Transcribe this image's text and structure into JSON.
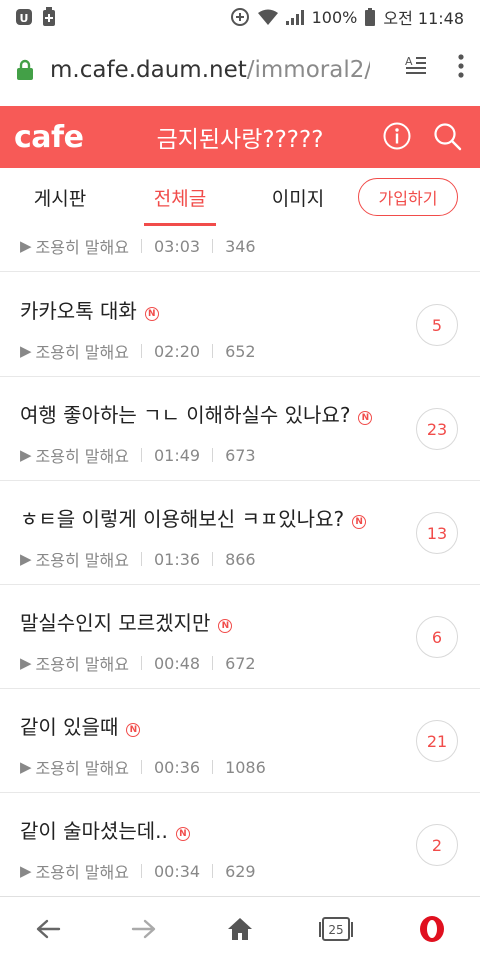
{
  "status_bar": {
    "battery": "100%",
    "time": "오전 11:48"
  },
  "browser": {
    "url_host": "m.cafe.daum.net",
    "url_path": "/immoral2/_",
    "icons": [
      "lock-icon",
      "reader-mode-icon",
      "more-vert-icon"
    ]
  },
  "header": {
    "logo": "cafe",
    "title": "금지된사랑?????",
    "icons": [
      "info-icon",
      "search-icon"
    ],
    "color": "#f75a57"
  },
  "tabs": [
    {
      "label": "게시판",
      "active": false
    },
    {
      "label": "전체글",
      "active": true
    },
    {
      "label": "이미지",
      "active": false
    }
  ],
  "join_button": "가입하기",
  "posts": [
    {
      "title": "",
      "author": "조용히 말해요",
      "time": "03:03",
      "views": "346",
      "comments": ""
    },
    {
      "title": "카카오톡 대화",
      "new": "N",
      "author": "조용히 말해요",
      "time": "02:20",
      "views": "652",
      "comments": "5"
    },
    {
      "title": "여행 좋아하는 ㄱㄴ 이해하실수 있나요?",
      "new": "N",
      "author": "조용히 말해요",
      "time": "01:49",
      "views": "673",
      "comments": "23"
    },
    {
      "title": "ㅎㅌ을 이렇게 이용해보신 ㅋㅍ있나요?",
      "new": "N",
      "author": "조용히 말해요",
      "time": "01:36",
      "views": "866",
      "comments": "13"
    },
    {
      "title": "말실수인지 모르겠지만",
      "new": "N",
      "author": "조용히 말해요",
      "time": "00:48",
      "views": "672",
      "comments": "6"
    },
    {
      "title": "같이 있을때",
      "new": "N",
      "author": "조용히 말해요",
      "time": "00:36",
      "views": "1086",
      "comments": "21"
    },
    {
      "title": "같이 술마셨는데..",
      "new": "N",
      "author": "조용히 말해요",
      "time": "00:34",
      "views": "629",
      "comments": "2"
    }
  ],
  "bottom_nav": {
    "icons": [
      "back-arrow-icon",
      "forward-arrow-icon",
      "home-icon",
      "tabs-icon",
      "opera-icon"
    ],
    "tab_count": "25"
  },
  "accent_color": "#f14c4a"
}
